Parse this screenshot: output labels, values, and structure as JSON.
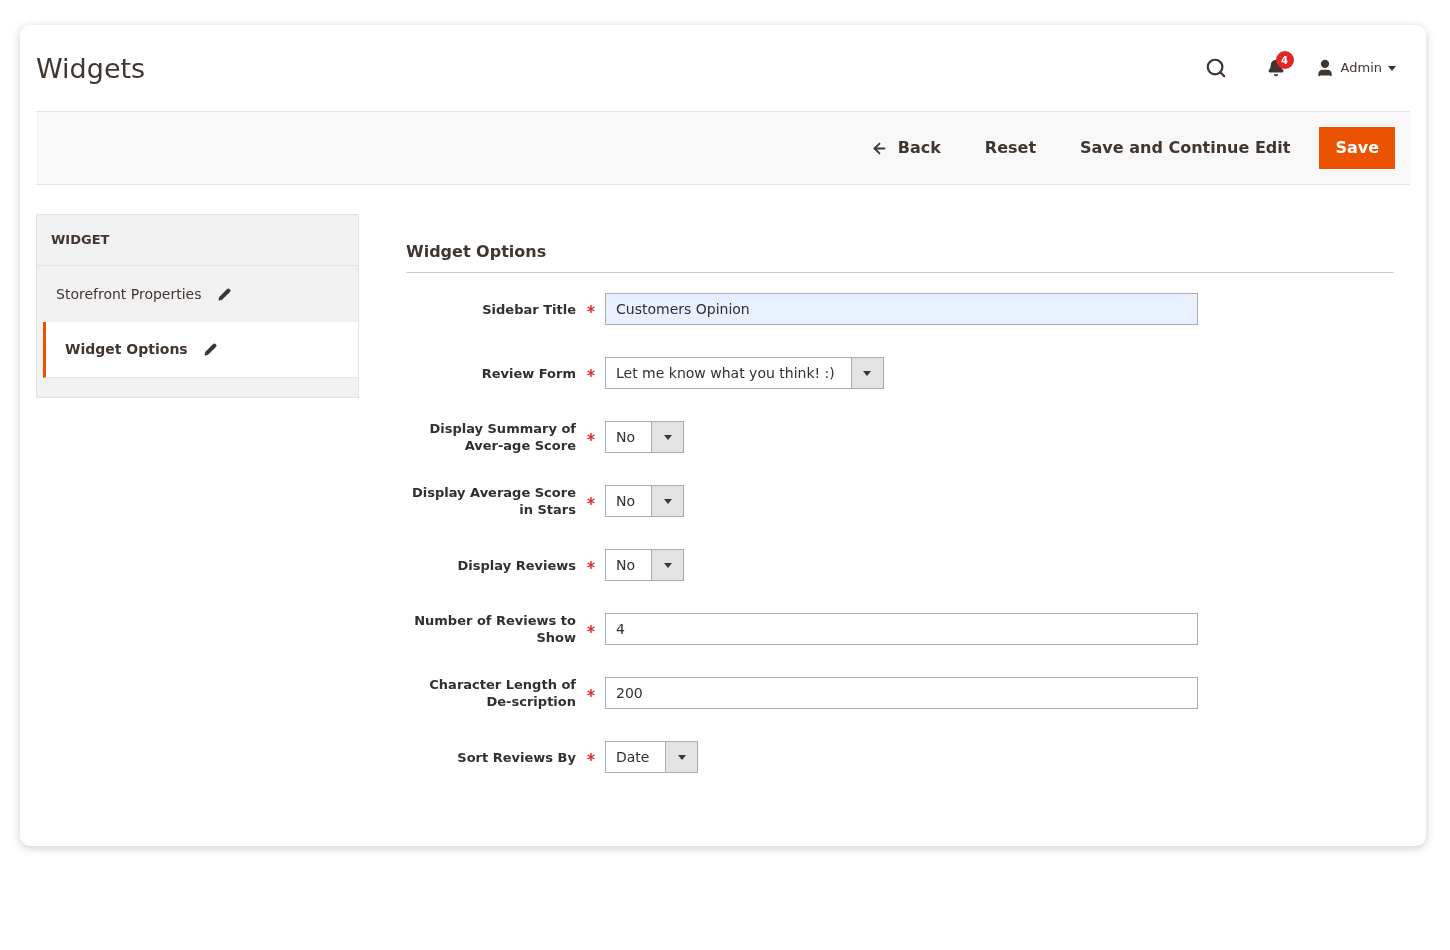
{
  "header": {
    "title": "Widgets",
    "notifications_count": "4",
    "user": "Admin"
  },
  "toolbar": {
    "buttons": [
      {
        "label": "Back",
        "kind": "back"
      },
      {
        "label": "Reset",
        "kind": "plain"
      },
      {
        "label": "Save and Continue Edit",
        "kind": "plain"
      },
      {
        "label": "Save",
        "kind": "primary"
      }
    ]
  },
  "sidebar": {
    "heading": "WIDGET",
    "items": [
      {
        "label": "Storefront Properties",
        "selected": false
      },
      {
        "label": "Widget Options",
        "selected": true
      }
    ]
  },
  "form": {
    "title": "Widget Options",
    "fields": [
      {
        "label": "Sidebar Title",
        "kind": "text",
        "value": "Customers Opinion",
        "required": true,
        "focused": true
      },
      {
        "label": "Review Form",
        "kind": "select",
        "value": "Let me know what you think! :)",
        "required": true
      },
      {
        "label": "Display Summary of Aver-age Score",
        "kind": "select",
        "value": "No",
        "required": true
      },
      {
        "label": "Display Average Score in Stars",
        "kind": "select",
        "value": "No",
        "required": true
      },
      {
        "label": "Display Reviews",
        "kind": "select",
        "value": "No",
        "required": true
      },
      {
        "label": "Number of Reviews to Show",
        "kind": "text",
        "value": "4",
        "required": true,
        "focused": false
      },
      {
        "label": "Character Length of De-scription",
        "kind": "text",
        "value": "200",
        "required": true,
        "focused": false
      },
      {
        "label": "Sort Reviews By",
        "kind": "select",
        "value": "Date",
        "required": true
      }
    ]
  }
}
